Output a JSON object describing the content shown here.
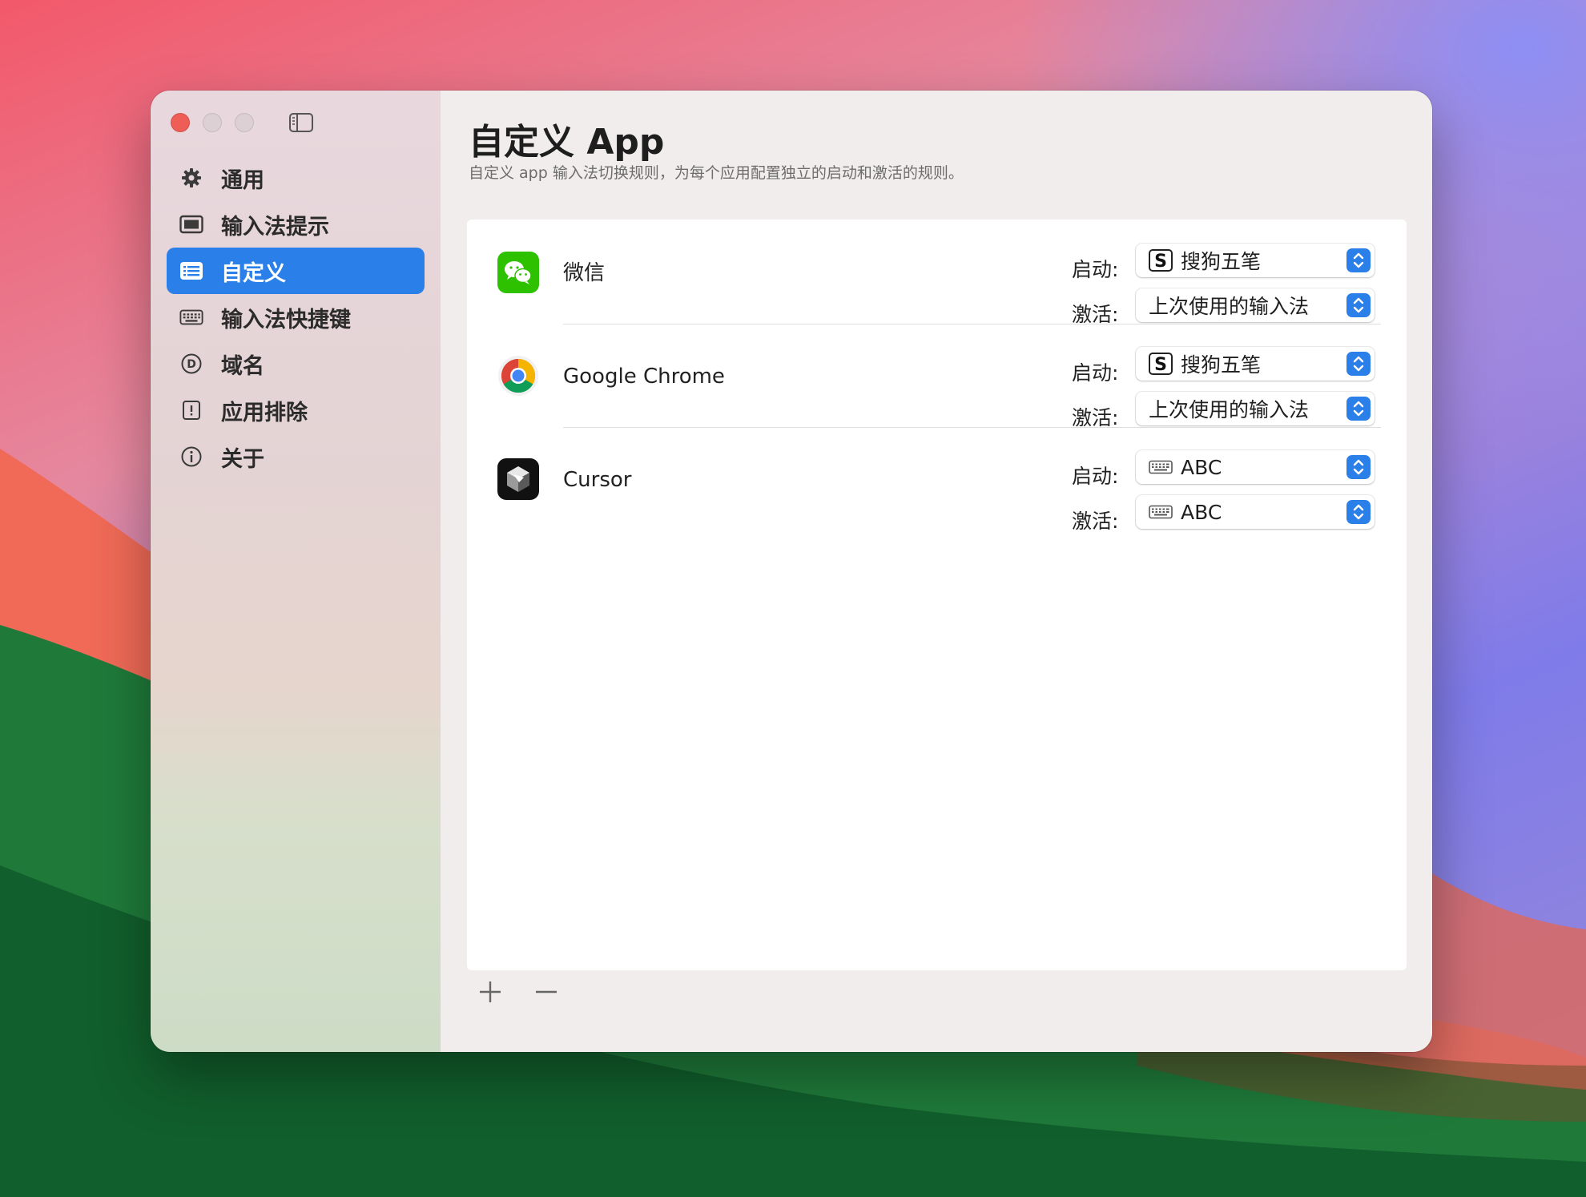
{
  "window": {
    "title": "自定义 App",
    "subtitle": "自定义 app 输入法切换规则，为每个应用配置独立的启动和激活的规则。"
  },
  "sidebar": {
    "items": [
      {
        "label": "通用",
        "icon": "gear-icon",
        "active": false
      },
      {
        "label": "输入法提示",
        "icon": "display-icon",
        "active": false
      },
      {
        "label": "自定义",
        "icon": "list-icon",
        "active": true
      },
      {
        "label": "输入法快捷键",
        "icon": "keyboard-icon",
        "active": false
      },
      {
        "label": "域名",
        "icon": "domain-icon",
        "active": false
      },
      {
        "label": "应用排除",
        "icon": "exclamation-icon",
        "active": false
      },
      {
        "label": "关于",
        "icon": "info-icon",
        "active": false
      }
    ]
  },
  "labels": {
    "launch": "启动:",
    "activate": "激活:"
  },
  "apps": [
    {
      "name": "微信",
      "icon": "wechat-icon",
      "launch": "搜狗五笔",
      "launch_icon": "sogou-icon",
      "activate": "上次使用的输入法",
      "activate_icon": ""
    },
    {
      "name": "Google Chrome",
      "icon": "chrome-icon",
      "launch": "搜狗五笔",
      "launch_icon": "sogou-icon",
      "activate": "上次使用的输入法",
      "activate_icon": ""
    },
    {
      "name": "Cursor",
      "icon": "cursor-app-icon",
      "launch": "ABC",
      "launch_icon": "keyboard-icon",
      "activate": "ABC",
      "activate_icon": "keyboard-icon"
    }
  ],
  "footer": {
    "add": "+",
    "remove": "−"
  },
  "colors": {
    "accent": "#2b7fe8",
    "close": "#ee5e56",
    "wechat": "#2dc100"
  }
}
